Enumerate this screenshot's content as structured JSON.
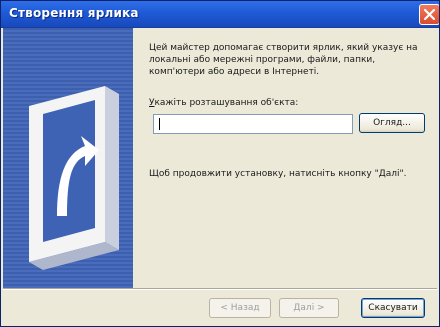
{
  "window": {
    "title": "Створення ярлика",
    "close_icon": "close-icon"
  },
  "content": {
    "description": "Цей майстер допомагає створити ярлик, який указує на локальні або мережні програми, файли, папки, комп'ютери або адреси в Інтернеті.",
    "location_label_underlined": "У",
    "location_label_rest": "кажіть розташування об'єкта:",
    "location_value": "",
    "browse_label": "Огляд...",
    "hint": "Щоб продовжити установку, натисніть кнопку \"Далі\"."
  },
  "buttons": {
    "back_label": "< Назад",
    "next_label": "Далі >",
    "cancel_label": "Скасувати"
  },
  "colors": {
    "titlebar": "#1f5ad6",
    "panel": "#3d5fae",
    "dialog_bg": "#ece9d8"
  }
}
